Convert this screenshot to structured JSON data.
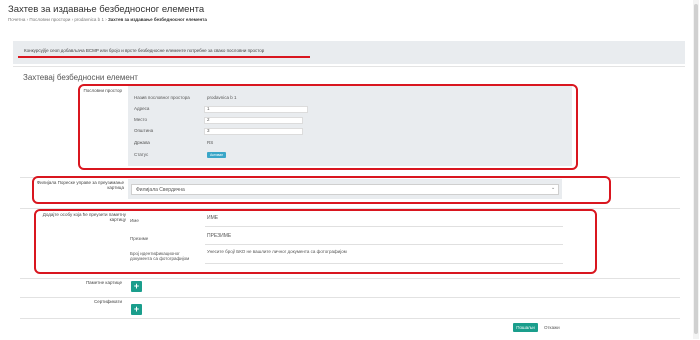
{
  "page": {
    "title": "Захтев за издавање безбедносног елемента",
    "breadcrumbs": [
      "Почетна",
      "Пословни простори",
      "prodavnica b 1",
      "Захтев за издавање безбедносног елемента"
    ]
  },
  "info": {
    "text": "Конкурсуј/је сеоп добављача BCMP или бројо и врсте безбедносне елементе потребне за свако пословни простор"
  },
  "form": {
    "section_title": "Захтевај безбедносни елемент",
    "business_space": {
      "label": "Пословни простор",
      "rows": [
        {
          "label": "Назив пословног простора",
          "value": "prodavnica b 1"
        },
        {
          "label": "Адреса",
          "value": "1"
        },
        {
          "label": "Место",
          "value": "2"
        },
        {
          "label": "Општина",
          "value": "3"
        },
        {
          "label": "Држава",
          "value": "RS"
        },
        {
          "label": "Статус",
          "value": "Активан"
        }
      ]
    },
    "pickup": {
      "label": "Филијала Пореске управе за преузимање картица",
      "selected": "Филијала Свердична"
    },
    "person": {
      "label": "Додајте особу која ће преузети паметну картицу",
      "first_name_label": "Име",
      "first_name_value": "ИМЕ",
      "last_name_label": "Презиме",
      "last_name_value": "ПРЕЗИМЕ",
      "id_doc_label": "Број идентификационог документа са фотографијом",
      "id_doc_placeholder": "Унесите број/ БКО не вашлите личног документа са фотографијом"
    },
    "smart_cards_label": "Паметне картице",
    "certificates_label": "Сертификати",
    "add_icon": "+",
    "submit_label": "Пошаљи",
    "cancel_label": "Откажи"
  },
  "colors": {
    "accent": "#1a9e8c",
    "highlight": "#d9161f",
    "badge": "#3aa6c8"
  }
}
